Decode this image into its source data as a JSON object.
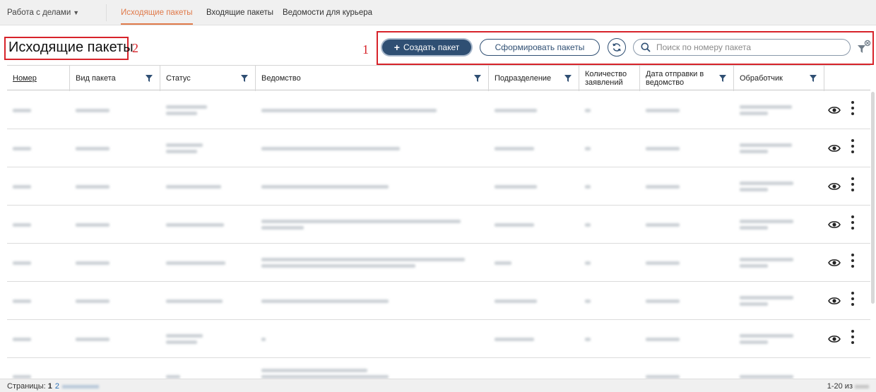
{
  "nav": {
    "workspace": "Работа с делами",
    "tabs": [
      {
        "label": "Исходящие пакеты"
      },
      {
        "label": "Входящие пакеты"
      },
      {
        "label": "Ведомости для курьера"
      }
    ]
  },
  "page": {
    "title": "Исходящие пакеты",
    "annotation_title": "2",
    "annotation_toolbar": "1"
  },
  "toolbar": {
    "create_label": "Создать пакет",
    "form_label": "Сформировать пакеты",
    "search_placeholder": "Поиск по номеру пакета",
    "search_value": ""
  },
  "table": {
    "columns": [
      {
        "label": "Номер"
      },
      {
        "label": "Вид пакета"
      },
      {
        "label": "Статус"
      },
      {
        "label": "Ведомство"
      },
      {
        "label": "Подразделение"
      },
      {
        "label": "Количество заявлений"
      },
      {
        "label": "Дата отправки в ведомство"
      },
      {
        "label": "Обработчик"
      }
    ]
  },
  "footer": {
    "pages_label": "Страницы:",
    "current_page": "1",
    "next_page": "2",
    "range_label": "1-20 из"
  },
  "colors": {
    "accent": "#2f4f73",
    "active_tab": "#e07a4a",
    "annotation": "#d7232a"
  },
  "icons": [
    "chevron-down-icon",
    "plus-icon",
    "refresh-icon",
    "search-icon",
    "filter-clear-icon",
    "filter-icon",
    "eye-icon",
    "kebab-menu-icon"
  ]
}
